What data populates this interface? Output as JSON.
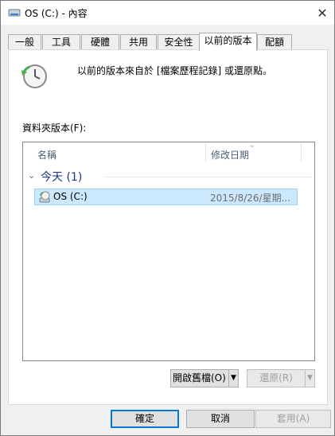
{
  "window": {
    "title": "OS (C:) - 內容",
    "close_glyph": "✕"
  },
  "tabs": [
    {
      "label": "一般"
    },
    {
      "label": "工具"
    },
    {
      "label": "硬體"
    },
    {
      "label": "共用"
    },
    {
      "label": "安全性"
    },
    {
      "label": "以前的版本",
      "active": true
    },
    {
      "label": "配額"
    }
  ],
  "panel": {
    "description": "以前的版本來自於 [檔案歷程記錄] 或還原點。",
    "list_label": "資料夾版本(F):",
    "columns": {
      "name": "名稱",
      "date": "修改日期"
    },
    "sort_glyph": "⌄",
    "group": {
      "label": "今天 (1)",
      "chevron": "⌄"
    },
    "rows": [
      {
        "name": "OS (C:)",
        "date": "2015/8/26/星期..."
      }
    ],
    "open_button": {
      "label": "開啟舊檔(O)",
      "arrow": "▼"
    },
    "restore_button": {
      "label": "還原(R)",
      "arrow": "▼"
    }
  },
  "footer": {
    "ok": "確定",
    "cancel": "取消",
    "apply": "套用(A)"
  },
  "colors": {
    "selection_bg": "#cce8ff",
    "selection_border": "#99d1ff",
    "accent": "#0078d7",
    "group_text": "#1e3287"
  }
}
